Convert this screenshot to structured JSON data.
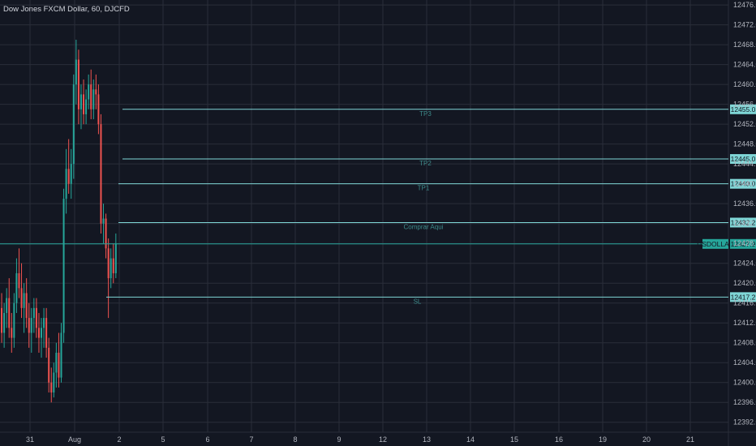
{
  "chart_data": {
    "type": "candlestick",
    "title": "Dow Jones FXCM Dollar, 60, DJCFD",
    "symbol_tag": "USDOLLAR",
    "last_price": 12427.9,
    "ylim": [
      12390,
      12477
    ],
    "y_ticks": [
      12476.0,
      12472.0,
      12468.0,
      12464.0,
      12460.0,
      12456.0,
      12452.0,
      12448.0,
      12444.0,
      12440.0,
      12436.0,
      12432.0,
      12428.0,
      12424.0,
      12420.0,
      12416.0,
      12412.0,
      12408.0,
      12404.0,
      12400.0,
      12396.0,
      12392.0
    ],
    "x_tick_labels": [
      "31",
      "Aug",
      "2",
      "5",
      "6",
      "7",
      "8",
      "9",
      "12",
      "13",
      "14",
      "15",
      "16",
      "19",
      "20",
      "21"
    ],
    "levels": [
      {
        "label": "TP3",
        "value": 12455.0,
        "value_label": "12455.0"
      },
      {
        "label": "TP2",
        "value": 12445.0,
        "value_label": "12445.0"
      },
      {
        "label": "TP1",
        "value": 12440.0,
        "value_label": "12440.0"
      },
      {
        "label": "Comprar Aqui",
        "value": 12432.2,
        "value_label": "12432.2"
      },
      {
        "label": "SL",
        "value": 12417.2,
        "value_label": "12417.2"
      }
    ],
    "last_price_label": "12427.9",
    "candles": [
      {
        "o": 12420,
        "h": 12422,
        "l": 12413,
        "c": 12415
      },
      {
        "o": 12415,
        "h": 12418,
        "l": 12408,
        "c": 12410
      },
      {
        "o": 12410,
        "h": 12416,
        "l": 12407,
        "c": 12414
      },
      {
        "o": 12414,
        "h": 12419,
        "l": 12411,
        "c": 12417
      },
      {
        "o": 12417,
        "h": 12421,
        "l": 12409,
        "c": 12411
      },
      {
        "o": 12411,
        "h": 12414,
        "l": 12406,
        "c": 12409
      },
      {
        "o": 12409,
        "h": 12418,
        "l": 12407,
        "c": 12416
      },
      {
        "o": 12416,
        "h": 12425,
        "l": 12414,
        "c": 12422
      },
      {
        "o": 12422,
        "h": 12427,
        "l": 12417,
        "c": 12419
      },
      {
        "o": 12419,
        "h": 12424,
        "l": 12413,
        "c": 12415
      },
      {
        "o": 12415,
        "h": 12420,
        "l": 12410,
        "c": 12418
      },
      {
        "o": 12418,
        "h": 12421,
        "l": 12411,
        "c": 12413
      },
      {
        "o": 12413,
        "h": 12416,
        "l": 12407,
        "c": 12410
      },
      {
        "o": 12410,
        "h": 12415,
        "l": 12406,
        "c": 12413
      },
      {
        "o": 12413,
        "h": 12417,
        "l": 12410,
        "c": 12415
      },
      {
        "o": 12415,
        "h": 12417,
        "l": 12409,
        "c": 12411
      },
      {
        "o": 12411,
        "h": 12414,
        "l": 12406,
        "c": 12409
      },
      {
        "o": 12409,
        "h": 12413,
        "l": 12405,
        "c": 12411
      },
      {
        "o": 12411,
        "h": 12415,
        "l": 12407,
        "c": 12413
      },
      {
        "o": 12413,
        "h": 12415,
        "l": 12405,
        "c": 12407
      },
      {
        "o": 12407,
        "h": 12409,
        "l": 12398,
        "c": 12400
      },
      {
        "o": 12400,
        "h": 12403,
        "l": 12396,
        "c": 12398
      },
      {
        "o": 12398,
        "h": 12404,
        "l": 12397,
        "c": 12402
      },
      {
        "o": 12402,
        "h": 12408,
        "l": 12399,
        "c": 12406
      },
      {
        "o": 12406,
        "h": 12410,
        "l": 12399,
        "c": 12401
      },
      {
        "o": 12401,
        "h": 12412,
        "l": 12400,
        "c": 12410
      },
      {
        "o": 12410,
        "h": 12439,
        "l": 12408,
        "c": 12437
      },
      {
        "o": 12437,
        "h": 12447,
        "l": 12434,
        "c": 12443
      },
      {
        "o": 12443,
        "h": 12449,
        "l": 12438,
        "c": 12440
      },
      {
        "o": 12440,
        "h": 12447,
        "l": 12437,
        "c": 12444
      },
      {
        "o": 12444,
        "h": 12462,
        "l": 12441,
        "c": 12460
      },
      {
        "o": 12460,
        "h": 12469,
        "l": 12456,
        "c": 12465
      },
      {
        "o": 12465,
        "h": 12467,
        "l": 12452,
        "c": 12455
      },
      {
        "o": 12455,
        "h": 12460,
        "l": 12451,
        "c": 12458
      },
      {
        "o": 12458,
        "h": 12461,
        "l": 12452,
        "c": 12454
      },
      {
        "o": 12454,
        "h": 12459,
        "l": 12452,
        "c": 12457
      },
      {
        "o": 12457,
        "h": 12462,
        "l": 12455,
        "c": 12460
      },
      {
        "o": 12460,
        "h": 12463,
        "l": 12453,
        "c": 12455
      },
      {
        "o": 12455,
        "h": 12461,
        "l": 12453,
        "c": 12459
      },
      {
        "o": 12459,
        "h": 12462,
        "l": 12455,
        "c": 12458
      },
      {
        "o": 12458,
        "h": 12460,
        "l": 12450,
        "c": 12452
      },
      {
        "o": 12452,
        "h": 12454,
        "l": 12430,
        "c": 12432
      },
      {
        "o": 12432,
        "h": 12436,
        "l": 12428,
        "c": 12433
      },
      {
        "o": 12433,
        "h": 12434,
        "l": 12425,
        "c": 12427
      },
      {
        "o": 12427,
        "h": 12429,
        "l": 12413,
        "c": 12421
      },
      {
        "o": 12421,
        "h": 12427,
        "l": 12419,
        "c": 12425
      },
      {
        "o": 12425,
        "h": 12428,
        "l": 12420,
        "c": 12422
      },
      {
        "o": 12422,
        "h": 12430,
        "l": 12421,
        "c": 12427.9
      }
    ]
  },
  "colors": {
    "background": "#131722",
    "grid": "#2a2e39",
    "up": "#26a69a",
    "down": "#ef5350",
    "level_line": "#7fd6d6",
    "level_text": "#3e8c8c",
    "badge": "#7fd6d6",
    "last_price_badge": "#26a69a",
    "axis_text": "#b2b5be"
  }
}
